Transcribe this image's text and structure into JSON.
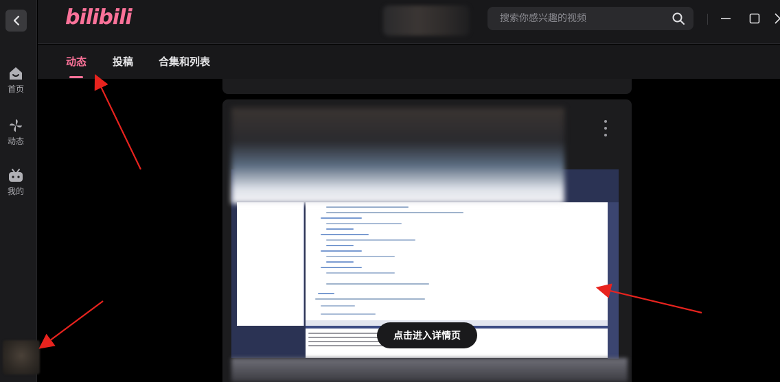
{
  "header": {
    "logo_text": "bilibili",
    "search_placeholder": "搜索你感兴趣的视频",
    "brand_color": "#fb7299"
  },
  "rail": {
    "items": [
      {
        "label": "首页",
        "icon": "home-icon"
      },
      {
        "label": "动态",
        "icon": "pinwheel-icon"
      },
      {
        "label": "我的",
        "icon": "tv-icon"
      }
    ]
  },
  "tabs": [
    {
      "label": "动态",
      "active": true
    },
    {
      "label": "投稿",
      "active": false
    },
    {
      "label": "合集和列表",
      "active": false
    }
  ],
  "card": {
    "detail_button_label": "点击进入详情页"
  }
}
